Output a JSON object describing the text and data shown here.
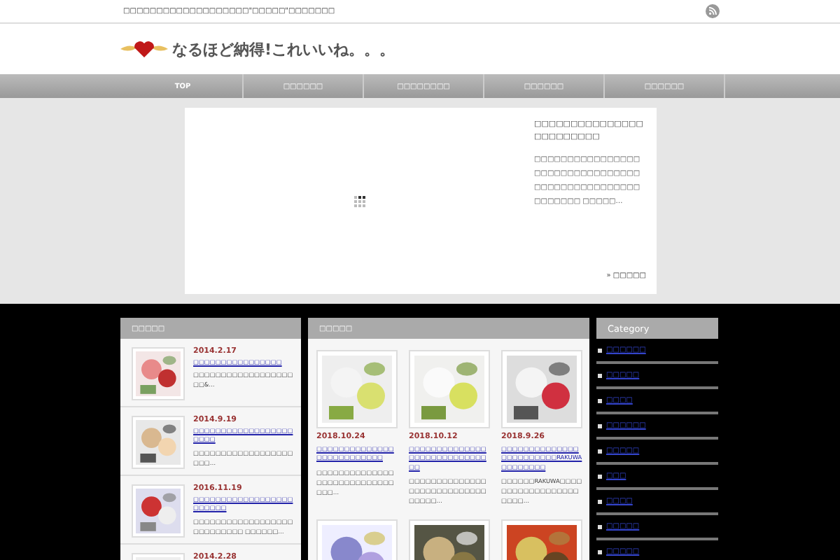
{
  "top_bar": {
    "tagline": "□□□□□□□□□□□□□□□□□□□\"□□□□□\"□□□□□□□"
  },
  "header": {
    "logo_text": "なるほど納得!これいいね。。。"
  },
  "nav": [
    {
      "label": "TOP"
    },
    {
      "label": "□□□□□□"
    },
    {
      "label": "□□□□□□□□"
    },
    {
      "label": "□□□□□□"
    },
    {
      "label": "□□□□□□"
    }
  ],
  "featured": {
    "title": "□□□□□□□□□□□□□□□□□□□□□□□□",
    "excerpt": "□□□□□□□□□□□□□□□□□□□□□□□□□□□□□□□□ □□□□□□□□□□□□□□□□□□□□□□□ □□□□□…",
    "read_more": "» □□□□□"
  },
  "recent_panel": {
    "heading": "□□□□□",
    "posts": [
      {
        "date": "2014.2.17",
        "title": "□□□□□□□□□□□□□□□□",
        "excerpt": "□□□□□□□□□□□□□□□□□□□□&…"
      },
      {
        "date": "2014.9.19",
        "title": "□□□□□□□□□□□□□□□□□□□□□□",
        "excerpt": "□□□□□□□□□□□□□□□□□□□□□…"
      },
      {
        "date": "2016.11.19",
        "title": "□□□□□□□□□□□□□□□□□□□□□□□□",
        "excerpt": "□□□□□□□□□□□□□□□□□□□□□□□□□□□ □□□□□□…"
      },
      {
        "date": "2014.2.28"
      }
    ]
  },
  "grid_panel": {
    "heading": "□□□□□",
    "posts": [
      {
        "kind": "post",
        "date": "2018.10.24",
        "title": "□□□□□□□□□□□□□□□□□□□□□□□□□□",
        "excerpt": "□□□□□□□□□□□□□□□□□□□□□□□□□□□□□□□…"
      },
      {
        "kind": "post",
        "date": "2018.10.12",
        "title": "□□□□□□□□□□□□□□□□□□□□□□□□□□□□□□",
        "excerpt": "□□□□□□□□□□□□□□□□□□□□□□□□□□□□□□□□□…"
      },
      {
        "kind": "post",
        "date": "2018.9.26",
        "title": "□□□□□□□□□□□□□□□□□□□□□□□□RAKUWA□□□□□□□□",
        "excerpt": "□□□□□□RAKUWA□□□□□□□□□□□□□□□□□□□□□□…"
      },
      {
        "kind": "picture"
      },
      {
        "kind": "picture"
      },
      {
        "kind": "picture"
      }
    ]
  },
  "categories": {
    "heading": "Category",
    "items": [
      "□□□□□□",
      "□□□□□",
      "□□□□",
      "□□□□□□",
      "□□□□□",
      "□□□",
      "□□□□",
      "□□□□□",
      "□□□□□"
    ]
  }
}
